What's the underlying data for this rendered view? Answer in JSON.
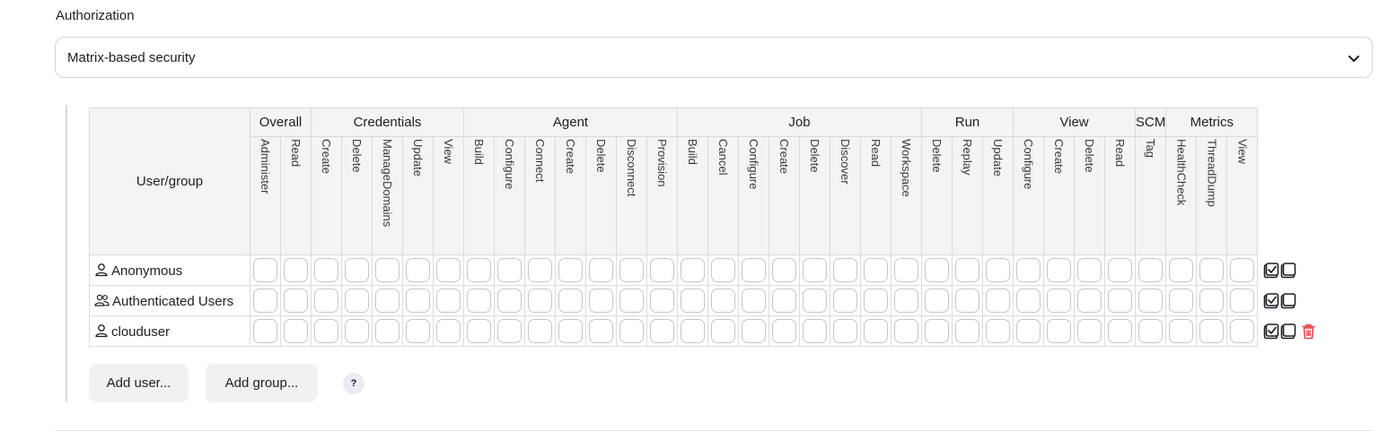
{
  "authorization": {
    "label": "Authorization",
    "strategy": "Matrix-based security",
    "dropdown_icon": "chevron-down-icon"
  },
  "matrix": {
    "user_header": "User/group",
    "groups": [
      {
        "name": "Overall",
        "permissions": [
          "Administer",
          "Read"
        ]
      },
      {
        "name": "Credentials",
        "permissions": [
          "Create",
          "Delete",
          "ManageDomains",
          "Update",
          "View"
        ]
      },
      {
        "name": "Agent",
        "permissions": [
          "Build",
          "Configure",
          "Connect",
          "Create",
          "Delete",
          "Disconnect",
          "Provision"
        ]
      },
      {
        "name": "Job",
        "permissions": [
          "Build",
          "Cancel",
          "Configure",
          "Create",
          "Delete",
          "Discover",
          "Read",
          "Workspace"
        ]
      },
      {
        "name": "Run",
        "permissions": [
          "Delete",
          "Replay",
          "Update"
        ]
      },
      {
        "name": "View",
        "permissions": [
          "Configure",
          "Create",
          "Delete",
          "Read"
        ]
      },
      {
        "name": "SCM",
        "permissions": [
          "Tag"
        ]
      },
      {
        "name": "Metrics",
        "permissions": [
          "HealthCheck",
          "ThreadDump",
          "View"
        ]
      }
    ],
    "rows": [
      {
        "name": "Anonymous",
        "icon": "user-icon",
        "deletable": false,
        "checked": []
      },
      {
        "name": "Authenticated Users",
        "icon": "users-icon",
        "deletable": false,
        "checked": []
      },
      {
        "name": "clouduser",
        "icon": "user-icon",
        "deletable": true,
        "checked": []
      }
    ],
    "row_actions": [
      "select-all-icon",
      "unselect-all-icon",
      "delete-icon"
    ],
    "delete_color": "#e0474c"
  },
  "buttons": {
    "add_user": "Add user...",
    "add_group": "Add group...",
    "help": "?"
  }
}
